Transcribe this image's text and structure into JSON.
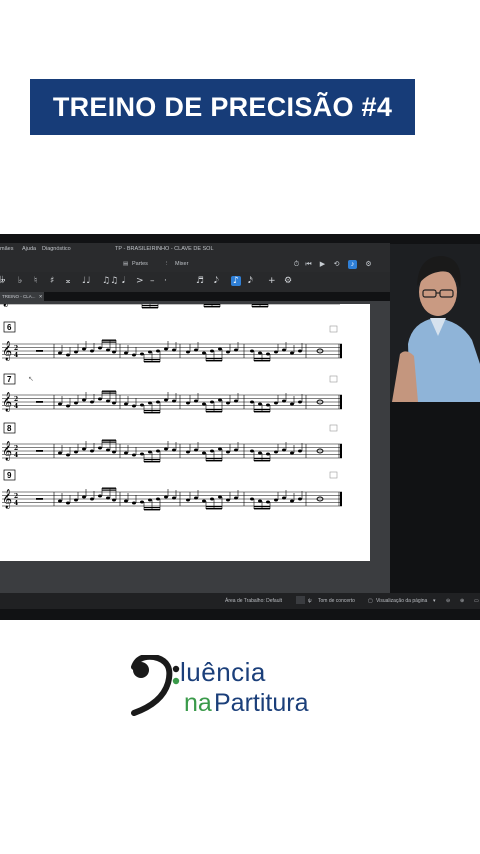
{
  "banner": {
    "title": "TREINO DE PRECISÃO #4"
  },
  "app": {
    "menu": [
      "mães",
      "Ajuda",
      "Diagnóstico"
    ],
    "document_title": "TP - BRASILEIRINHO - CLAVE DE SOL",
    "tabs": {
      "parts": "Partes",
      "mixer": "Mixer"
    },
    "document_tab": "TREINO - CLA...",
    "palette": [
      "𝄫",
      "♭",
      "♮",
      "♯",
      "𝄪",
      "♩♩",
      "♫♫",
      "𝅘𝅥",
      ">",
      "–",
      "·",
      "♬",
      "𝅘𝅥𝅮",
      "♪",
      "𝅘𝅥𝅯",
      "+",
      "⚙"
    ],
    "measures": [
      "6",
      "7",
      "8",
      "9"
    ],
    "status": {
      "workspace": "Área de Trabalho: Default",
      "concert": "Tom de concerto",
      "view": "Visualização da página"
    },
    "colors": {
      "accent": "#2f7fd6",
      "banner": "#173c78"
    }
  },
  "brand": {
    "line1": "luência",
    "line2a": "na",
    "line2b": "Partitura"
  }
}
